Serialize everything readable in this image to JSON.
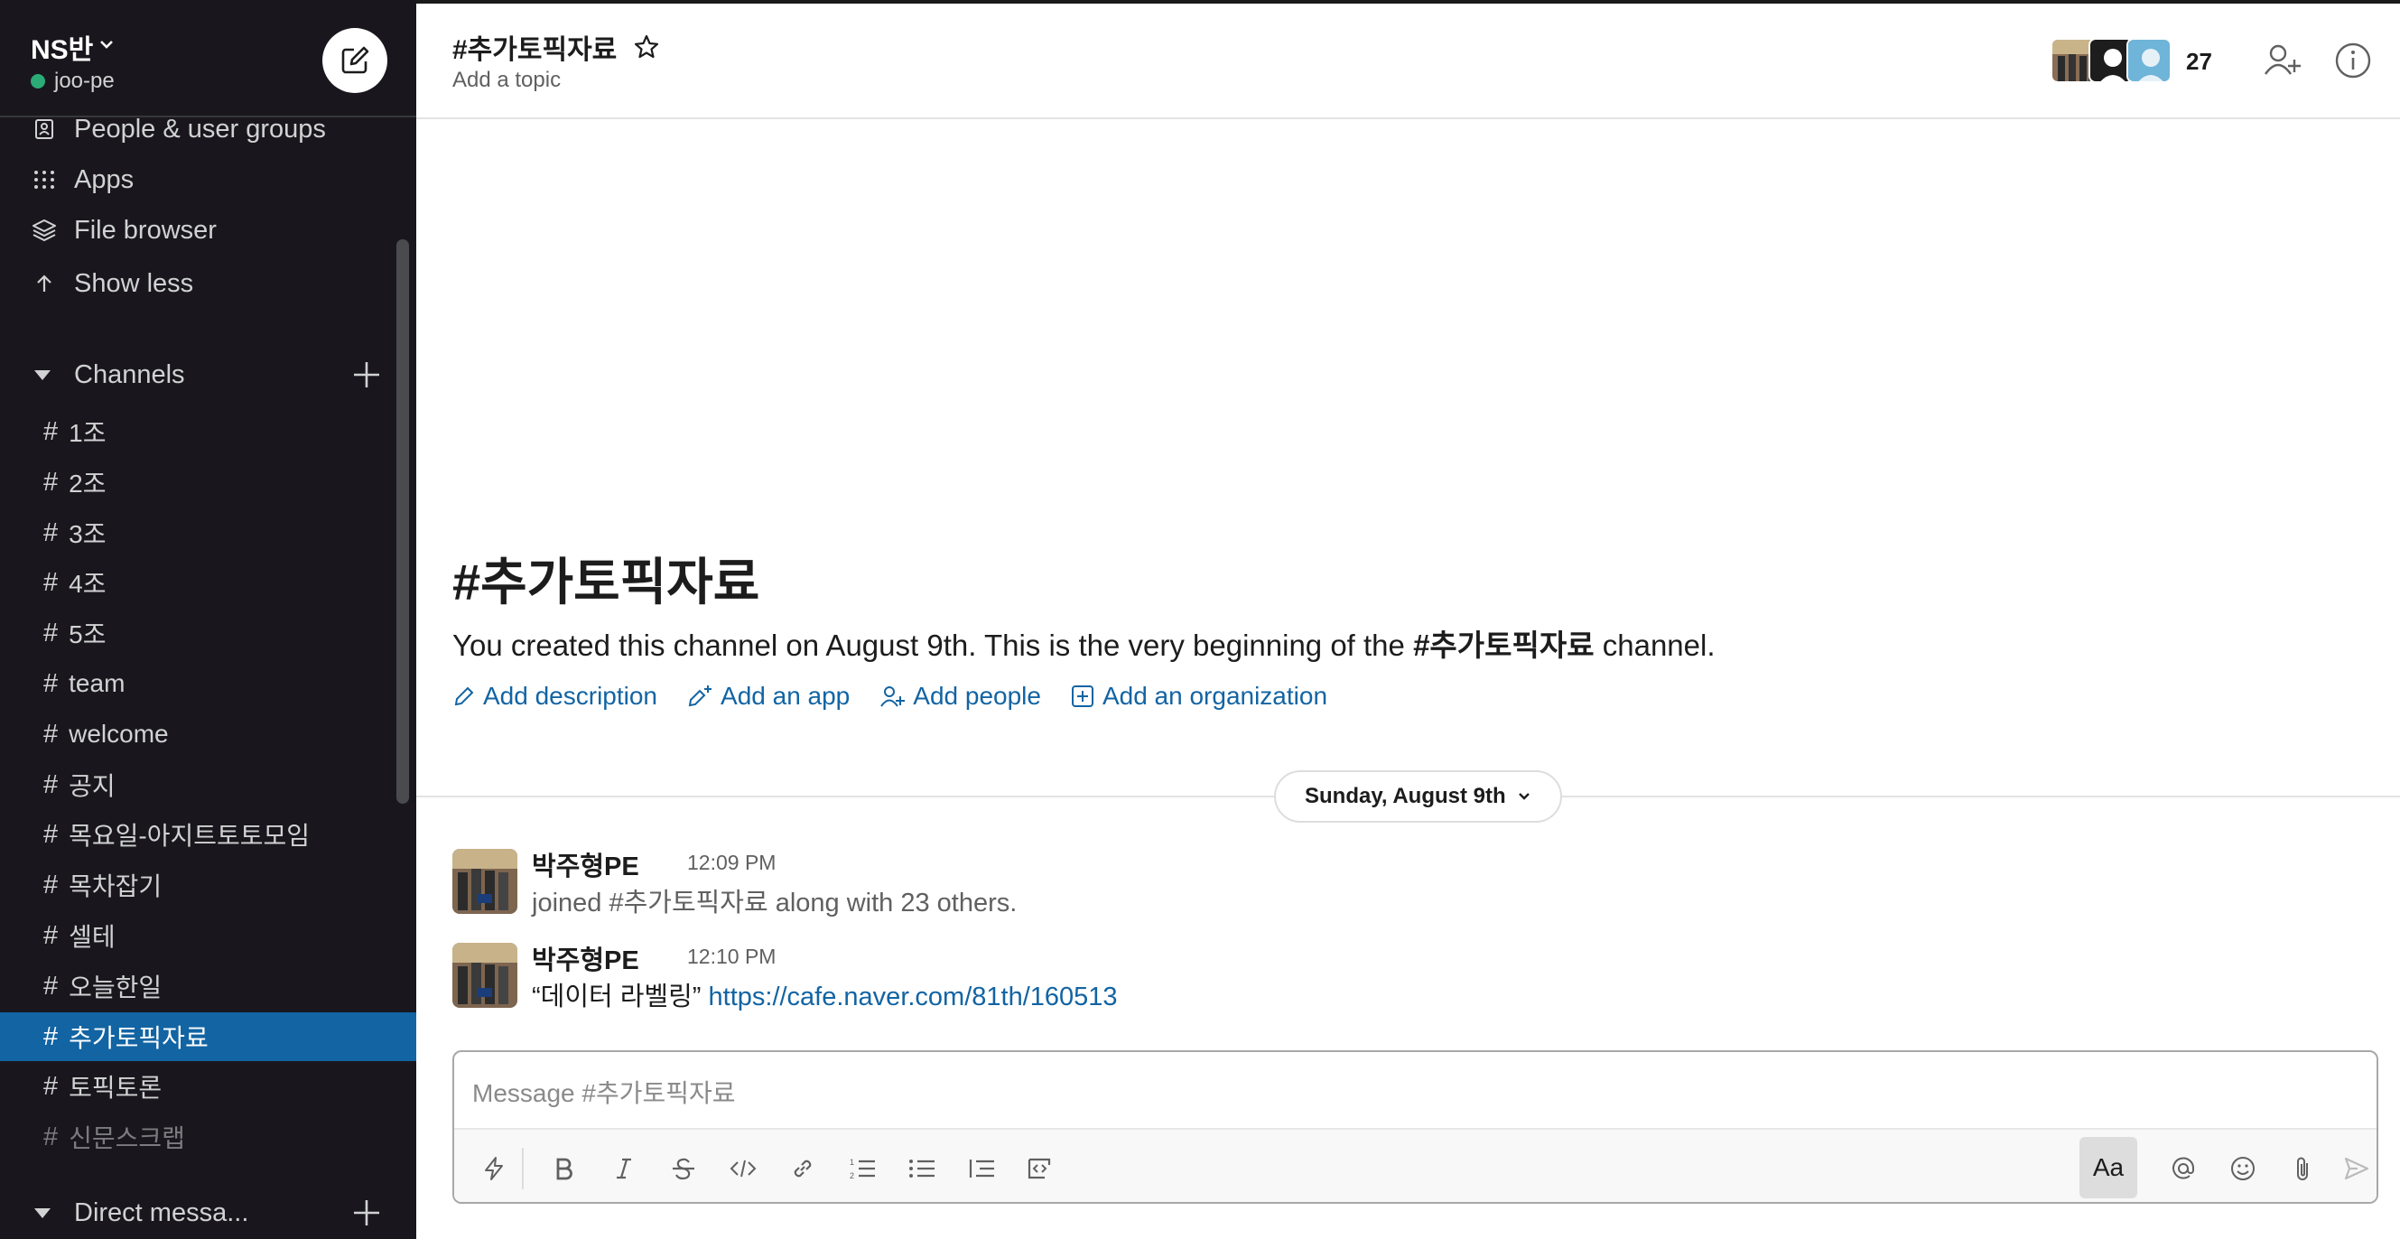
{
  "workspace": {
    "name": "NS반",
    "user": "joo-pe",
    "status_color": "#2bac76"
  },
  "sidebar": {
    "nav": [
      {
        "label": "People & user groups",
        "icon": "people-icon"
      },
      {
        "label": "Apps",
        "icon": "apps-grid-icon"
      },
      {
        "label": "File browser",
        "icon": "layers-icon"
      },
      {
        "label": "Show less",
        "icon": "arrow-up-icon"
      }
    ],
    "channels_label": "Channels",
    "channels": [
      {
        "name": "1조",
        "state": "normal"
      },
      {
        "name": "2조",
        "state": "normal"
      },
      {
        "name": "3조",
        "state": "normal"
      },
      {
        "name": "4조",
        "state": "normal"
      },
      {
        "name": "5조",
        "state": "normal"
      },
      {
        "name": "team",
        "state": "normal"
      },
      {
        "name": "welcome",
        "state": "normal"
      },
      {
        "name": "공지",
        "state": "normal"
      },
      {
        "name": "목요일-아지트토토모임",
        "state": "normal"
      },
      {
        "name": "목차잡기",
        "state": "normal"
      },
      {
        "name": "셀테",
        "state": "normal"
      },
      {
        "name": "오늘한일",
        "state": "normal"
      },
      {
        "name": "추가토픽자료",
        "state": "active"
      },
      {
        "name": "토픽토론",
        "state": "normal"
      },
      {
        "name": "신문스크랩",
        "state": "dim"
      }
    ],
    "dm_label": "Direct messa...",
    "hash": "#"
  },
  "header": {
    "title": "#추가토픽자료",
    "topic_placeholder": "Add a topic",
    "member_count": "27"
  },
  "intro": {
    "title": "#추가토픽자료",
    "text_before": "You created this channel on August 9th. This is the very beginning of the ",
    "text_channel": "#추가토픽자료",
    "text_after": " channel.",
    "actions": [
      {
        "label": "Add description",
        "icon": "pencil-icon"
      },
      {
        "label": "Add an app",
        "icon": "app-sparkle-icon"
      },
      {
        "label": "Add people",
        "icon": "add-person-icon"
      },
      {
        "label": "Add an organization",
        "icon": "plus-square-icon"
      }
    ]
  },
  "date_divider": "Sunday, August 9th",
  "messages": [
    {
      "sender": "박주형PE",
      "time": "12:09 PM",
      "text": "joined #추가토픽자료 along with 23 others.",
      "system": true
    },
    {
      "sender": "박주형PE",
      "time": "12:10 PM",
      "quote": "“데이터 라벨링”",
      "link": "https://cafe.naver.com/81th/160513"
    }
  ],
  "composer": {
    "placeholder": "Message #추가토픽자료",
    "aa_label": "Aa"
  },
  "colors": {
    "sidebar_bg": "#19171d",
    "active_channel": "#1264a3",
    "link": "#1264a3"
  }
}
